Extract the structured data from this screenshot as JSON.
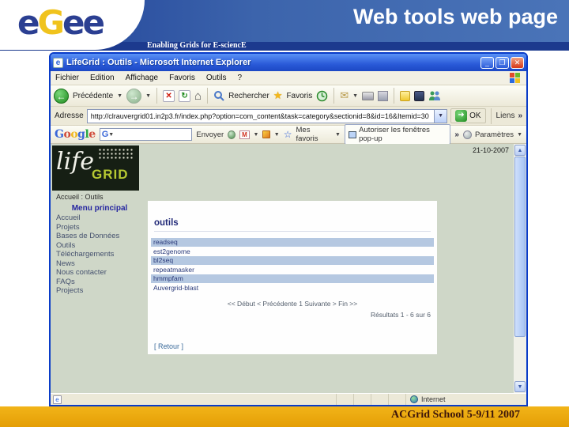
{
  "slide": {
    "logo_letters": [
      "e",
      "G",
      "e",
      "e"
    ],
    "tagline": "Enabling Grids for E-sciencE",
    "title": "Web tools web page",
    "footer": "ACGrid School 5-9/11 2007"
  },
  "browser": {
    "window_title": "LifeGrid : Outils - Microsoft Internet Explorer",
    "window_buttons": {
      "minimize": "_",
      "maximize": "❐",
      "close": "✕"
    },
    "menu": [
      "Fichier",
      "Edition",
      "Affichage",
      "Favoris",
      "Outils",
      "?"
    ],
    "toolbar": {
      "back_label": "Précédente",
      "search_label": "Rechercher",
      "favorites_label": "Favoris",
      "back_glyph": "←",
      "forward_glyph": "→",
      "stop_glyph": "✕",
      "refresh_glyph": "↻",
      "home_glyph": "⌂",
      "star_glyph": "★",
      "mail_glyph": "✉"
    },
    "address": {
      "label": "Adresse",
      "url": "http://clrauvergrid01.in2p3.fr/index.php?option=com_content&task=category&sectionid=8&id=16&Itemid=30",
      "ok_label": "OK",
      "ok_glyph": "➜",
      "links_label": "Liens",
      "more_glyph": "»",
      "drop_glyph": "▼"
    },
    "google": {
      "logo_letters": [
        "G",
        "o",
        "o",
        "g",
        "l",
        "e"
      ],
      "g_glyph": "G",
      "send_label": "Envoyer",
      "favorites_label": "Mes favoris",
      "popup_label": "Autoriser les fenêtres pop-up",
      "settings_label": "Paramètres",
      "gmail_glyph": "M",
      "star_glyph": "☆",
      "more_glyph": "»",
      "drop_glyph": "▼"
    },
    "scrollbar": {
      "up_glyph": "▲",
      "down_glyph": "▼"
    },
    "status": {
      "zone": "Internet",
      "doc_glyph": "e"
    }
  },
  "page": {
    "date": "21-10-2007",
    "site_logo": {
      "life": "life",
      "grid": "GRID"
    },
    "breadcrumb": "Accueil : Outils",
    "menu": {
      "title": "Menu principal",
      "items": [
        "Accueil",
        "Projets",
        "Bases de Données",
        "Outils",
        "Téléchargements",
        "News",
        "Nous contacter",
        "FAQs",
        "Projects"
      ]
    },
    "content": {
      "heading": "outils",
      "tools": [
        "readseq",
        "est2genome",
        "bl2seq",
        "repeatmasker",
        "hmmpfam",
        "Auvergrid-blast"
      ],
      "pagination": "<< Début < Précédente 1 Suivante > Fin >>",
      "results": "Résultats 1 - 6 sur 6",
      "back": "[ Retour ]"
    }
  },
  "colors": {
    "header_blue": "#4a74b8",
    "header_dark_blue": "#1c3a8e",
    "footer_orange": "#eaa70f",
    "content_bg": "#cfd7c8",
    "row_blue": "#b5c8e1",
    "xp_titlebar_blue": "#2a5ad8",
    "egee_yellow": "#f0c31d",
    "lifegrid_green": "#b6c832"
  }
}
